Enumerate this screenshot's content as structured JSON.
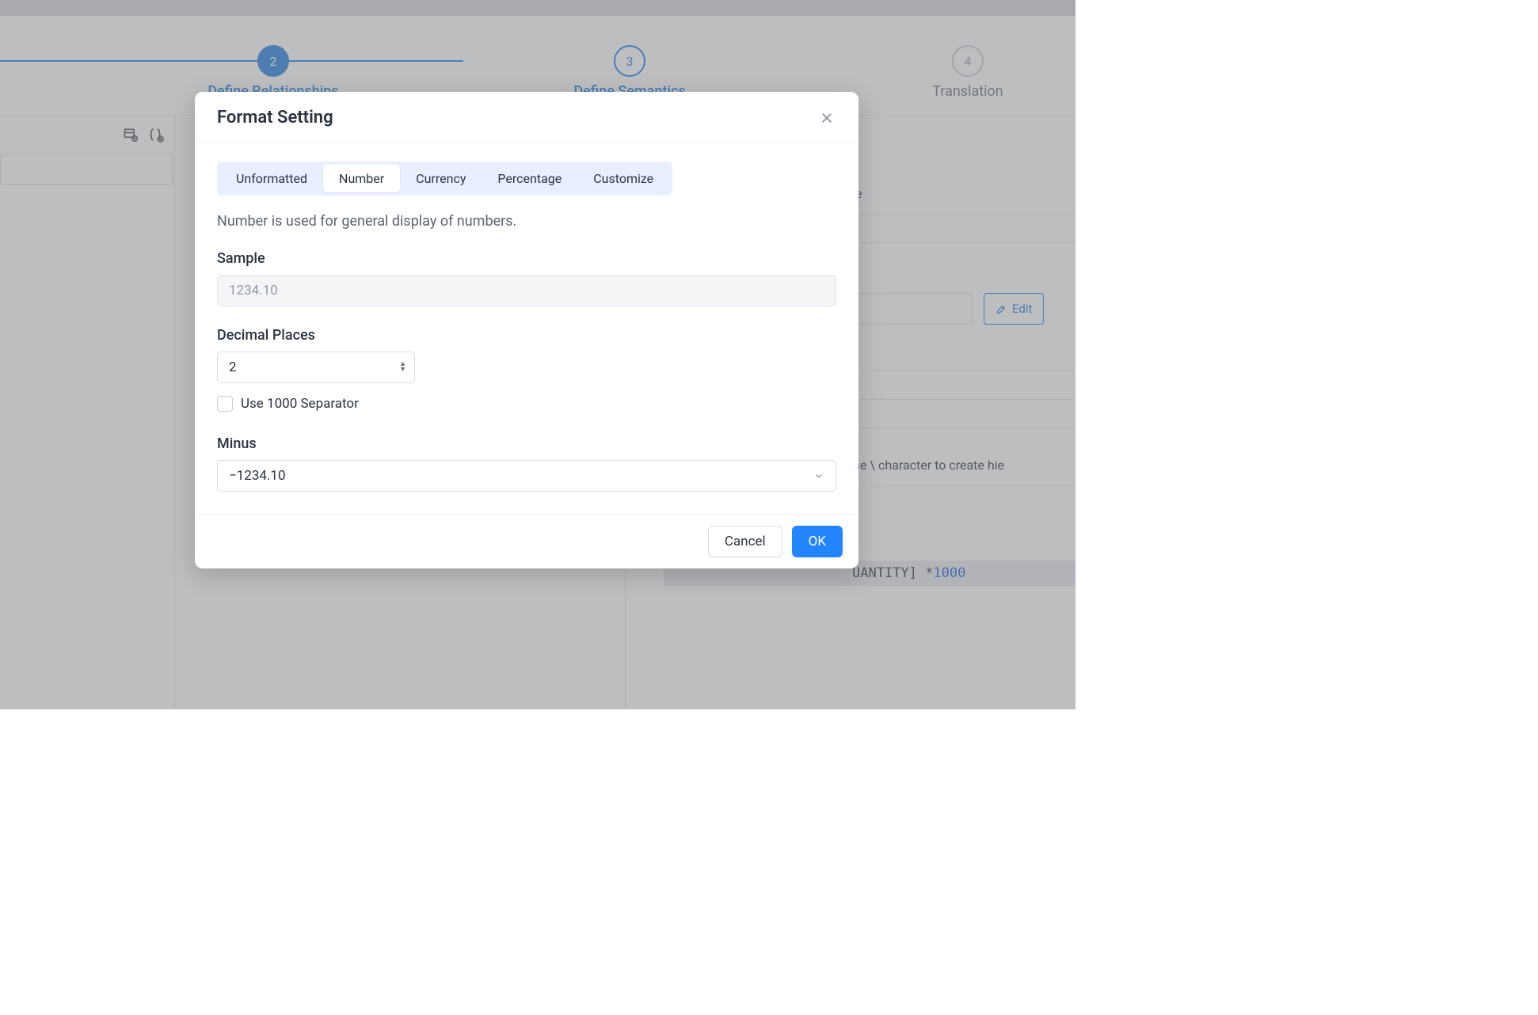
{
  "stepper": {
    "step2": {
      "num": "2",
      "label": "Define Relationships"
    },
    "step3": {
      "num": "3",
      "label": "Define Semantics"
    },
    "step4": {
      "num": "4",
      "label": "Translation"
    }
  },
  "background": {
    "right_row1_fragment": "e",
    "edit_label": "Edit",
    "hint_fragment": "bers. Use \\ character to create hie",
    "code_fragment_mid": "UANTITY] * ",
    "code_fragment_num": "1000"
  },
  "dialog": {
    "title": "Format Setting",
    "tabs": {
      "unformatted": "Unformatted",
      "number": "Number",
      "currency": "Currency",
      "percentage": "Percentage",
      "customize": "Customize"
    },
    "description": "Number is used for general display of numbers.",
    "sample_label": "Sample",
    "sample_value": "1234.10",
    "decimal_label": "Decimal Places",
    "decimal_value": "2",
    "thousand_sep_label": "Use 1000 Separator",
    "minus_label": "Minus",
    "minus_value": "−1234.10",
    "cancel": "Cancel",
    "ok": "OK"
  }
}
